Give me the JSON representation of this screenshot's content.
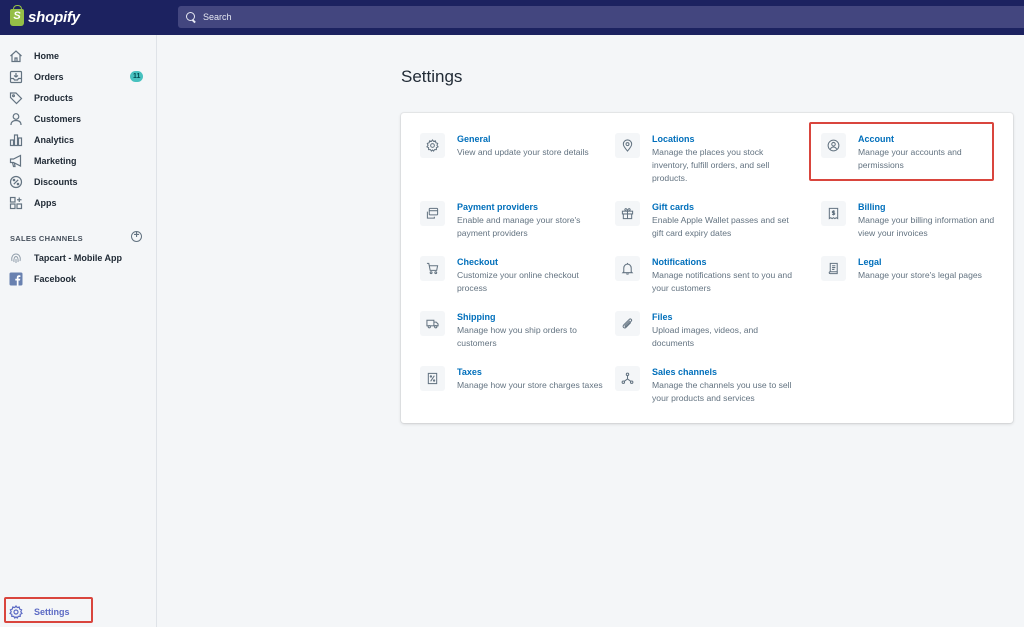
{
  "brand": {
    "name": "shopify"
  },
  "search": {
    "placeholder": "Search"
  },
  "sidebar": {
    "items": [
      {
        "label": "Home",
        "icon": "home-icon"
      },
      {
        "label": "Orders",
        "icon": "orders-icon",
        "badge": "11"
      },
      {
        "label": "Products",
        "icon": "tag-icon"
      },
      {
        "label": "Customers",
        "icon": "person-icon"
      },
      {
        "label": "Analytics",
        "icon": "bar-chart-icon"
      },
      {
        "label": "Marketing",
        "icon": "megaphone-icon"
      },
      {
        "label": "Discounts",
        "icon": "discount-icon"
      },
      {
        "label": "Apps",
        "icon": "apps-icon"
      }
    ],
    "sales_channels_label": "SALES CHANNELS",
    "channels": [
      {
        "label": "Tapcart - Mobile App",
        "icon": "fingerprint-icon"
      },
      {
        "label": "Facebook",
        "icon": "facebook-icon"
      }
    ],
    "settings_label": "Settings"
  },
  "main": {
    "title": "Settings",
    "tiles": [
      {
        "title": "General",
        "desc": "View and update your store details",
        "icon": "gear-icon"
      },
      {
        "title": "Locations",
        "desc": "Manage the places you stock inventory, fulfill orders, and sell products.",
        "icon": "location-pin-icon"
      },
      {
        "title": "Account",
        "desc": "Manage your accounts and permissions",
        "icon": "account-icon"
      },
      {
        "title": "Payment providers",
        "desc": "Enable and manage your store's payment providers",
        "icon": "payment-icon"
      },
      {
        "title": "Gift cards",
        "desc": "Enable Apple Wallet passes and set gift card expiry dates",
        "icon": "gift-icon"
      },
      {
        "title": "Billing",
        "desc": "Manage your billing information and view your invoices",
        "icon": "billing-icon"
      },
      {
        "title": "Checkout",
        "desc": "Customize your online checkout process",
        "icon": "cart-icon"
      },
      {
        "title": "Notifications",
        "desc": "Manage notifications sent to you and your customers",
        "icon": "bell-icon"
      },
      {
        "title": "Legal",
        "desc": "Manage your store's legal pages",
        "icon": "legal-icon"
      },
      {
        "title": "Shipping",
        "desc": "Manage how you ship orders to customers",
        "icon": "truck-icon"
      },
      {
        "title": "Files",
        "desc": "Upload images, videos, and documents",
        "icon": "paperclip-icon"
      },
      {
        "title": "Taxes",
        "desc": "Manage how your store charges taxes",
        "icon": "tax-icon"
      },
      {
        "title": "Sales channels",
        "desc": "Manage the channels you use to sell your products and services",
        "icon": "channels-icon"
      }
    ]
  },
  "colors": {
    "topbar": "#1c2260",
    "link": "#006fbb",
    "highlight": "#d9453d",
    "accent": "#5c6ac4"
  }
}
